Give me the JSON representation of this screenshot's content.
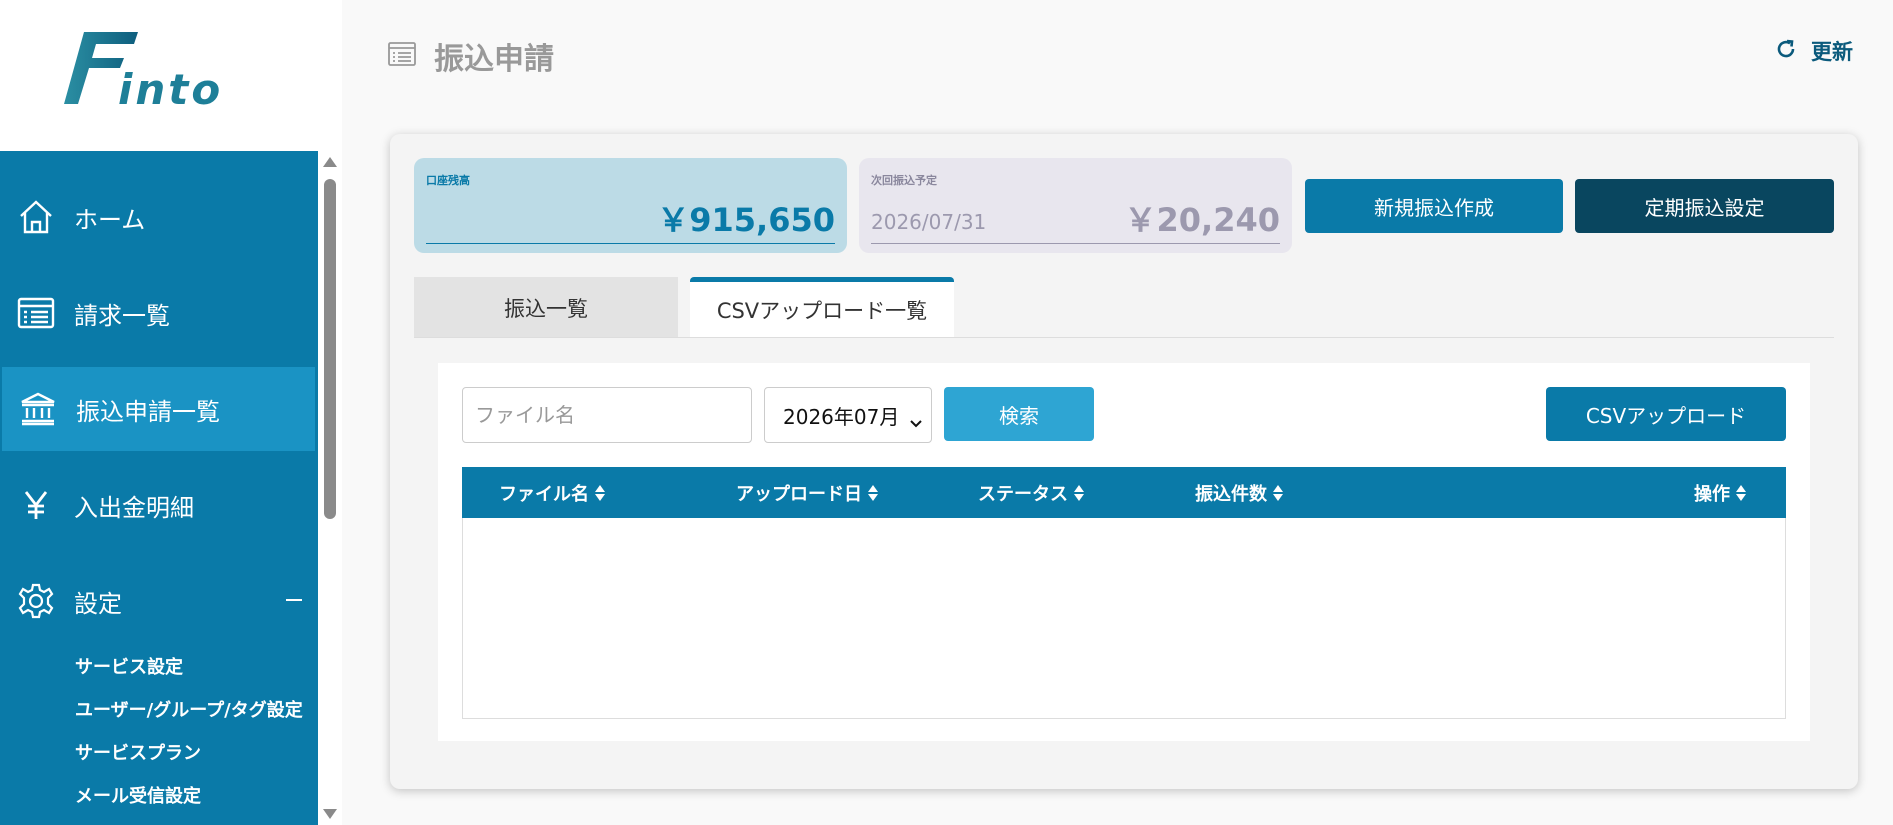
{
  "logo": {
    "text": "Finto"
  },
  "sidebar": {
    "items": [
      {
        "label": "ホーム",
        "icon": "home-icon"
      },
      {
        "label": "請求一覧",
        "icon": "invoice-list-icon"
      },
      {
        "label": "振込申請一覧",
        "icon": "bank-icon",
        "active": true
      },
      {
        "label": "入出金明細",
        "icon": "yen-icon"
      },
      {
        "label": "設定",
        "icon": "gear-icon",
        "expanded": true
      }
    ],
    "settings_subitems": [
      "サービス設定",
      "ユーザー/グループ/タグ設定",
      "サービスプラン",
      "メール受信設定"
    ]
  },
  "header": {
    "title": "振込申請",
    "refresh_label": "更新"
  },
  "summary": {
    "balance_label": "口座残高",
    "balance_amount": "￥915,650",
    "next_label": "次回振込予定",
    "next_date": "2026/07/31",
    "next_amount": "￥20,240"
  },
  "actions": {
    "new_transfer": "新規振込作成",
    "periodic_transfer": "定期振込設定"
  },
  "tabs": [
    {
      "label": "振込一覧",
      "active": false
    },
    {
      "label": "CSVアップロード一覧",
      "active": true
    }
  ],
  "filters": {
    "file_placeholder": "ファイル名",
    "month_value": "2026年07月",
    "search_label": "検索",
    "csv_upload_label": "CSVアップロード"
  },
  "table": {
    "columns": [
      "ファイル名",
      "アップロード日",
      "ステータス",
      "振込件数",
      "操作"
    ],
    "rows": []
  },
  "colors": {
    "primary": "#0a7aa8",
    "sidebar_active": "#1a93c4",
    "dark_button": "#09465f",
    "search_button": "#2ea5d3",
    "balance_bg": "#bcdbe6",
    "next_bg": "#e8e6ee"
  }
}
